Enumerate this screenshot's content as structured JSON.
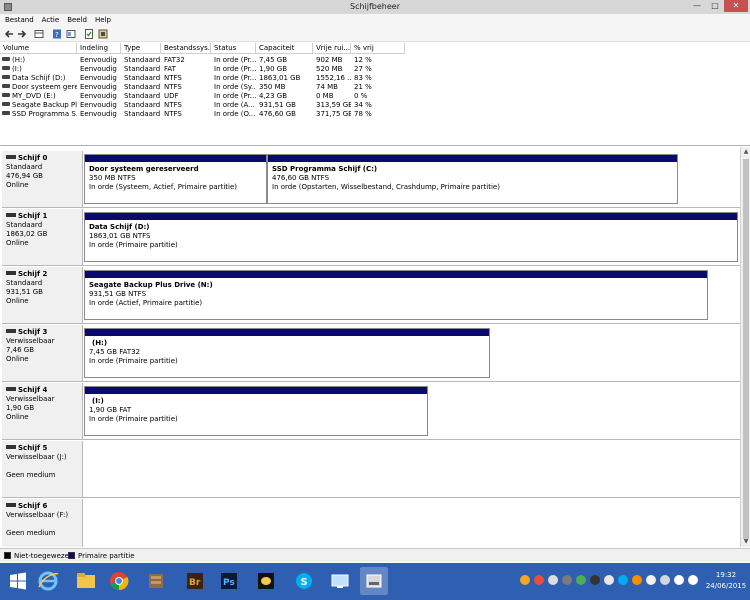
{
  "window": {
    "title": "Schijfbeheer"
  },
  "menu": [
    "Bestand",
    "Actie",
    "Beeld",
    "Help"
  ],
  "toolbar": {
    "icons": [
      "back-arrow-icon",
      "forward-arrow-icon",
      "list-view-icon",
      "help-icon",
      "properties-icon",
      "check-disk-icon",
      "disk-props-icon"
    ]
  },
  "volumes": {
    "columns": [
      "Volume",
      "Indeling",
      "Type",
      "Bestandssys...",
      "Status",
      "Capaciteit",
      "Vrije rui...",
      "% vrij"
    ],
    "rows": [
      [
        "(H:)",
        "Eenvoudig",
        "Standaard",
        "FAT32",
        "In orde (Pr...",
        "7,45 GB",
        "902 MB",
        "12 %"
      ],
      [
        "(I:)",
        "Eenvoudig",
        "Standaard",
        "FAT",
        "In orde (Pr...",
        "1,90 GB",
        "520 MB",
        "27 %"
      ],
      [
        "Data Schijf (D:)",
        "Eenvoudig",
        "Standaard",
        "NTFS",
        "In orde (Pr...",
        "1863,01 GB",
        "1552,16 ...",
        "83 %"
      ],
      [
        "Door systeem gere...",
        "Eenvoudig",
        "Standaard",
        "NTFS",
        "In orde (Sy...",
        "350 MB",
        "74 MB",
        "21 %"
      ],
      [
        "MY_DVD (E:)",
        "Eenvoudig",
        "Standaard",
        "UDF",
        "In orde (Pr...",
        "4,23 GB",
        "0 MB",
        "0 %"
      ],
      [
        "Seagate Backup Pl...",
        "Eenvoudig",
        "Standaard",
        "NTFS",
        "In orde (A...",
        "931,51 GB",
        "313,59 GB",
        "34 %"
      ],
      [
        "SSD Programma S...",
        "Eenvoudig",
        "Standaard",
        "NTFS",
        "In orde (O...",
        "476,60 GB",
        "371,75 GB",
        "78 %"
      ]
    ]
  },
  "disks": [
    {
      "name": "Schijf 0",
      "type": "Standaard",
      "size": "476,94 GB",
      "status": "Online",
      "partitions": [
        {
          "name": "Door systeem gereserveerd",
          "size": "350 MB NTFS",
          "status": "In orde (Systeem, Actief, Primaire partitie)"
        },
        {
          "name": "SSD Programma Schijf  (C:)",
          "size": "476,60 GB NTFS",
          "status": "In orde (Opstarten, Wisselbestand, Crashdump, Primaire partitie)"
        }
      ]
    },
    {
      "name": "Schijf 1",
      "type": "Standaard",
      "size": "1863,02 GB",
      "status": "Online",
      "partitions": [
        {
          "name": "Data Schijf  (D:)",
          "size": "1863,01 GB NTFS",
          "status": "In orde (Primaire partitie)"
        }
      ]
    },
    {
      "name": "Schijf 2",
      "type": "Standaard",
      "size": "931,51 GB",
      "status": "Online",
      "partitions": [
        {
          "name": "Seagate Backup Plus Drive  (N:)",
          "size": "931,51 GB NTFS",
          "status": "In orde (Actief, Primaire partitie)"
        }
      ]
    },
    {
      "name": "Schijf 3",
      "type": "Verwisselbaar",
      "size": "7,46 GB",
      "status": "Online",
      "partitions": [
        {
          "name": "(H:)",
          "size": "7,45 GB FAT32",
          "status": "In orde (Primaire partitie)"
        }
      ]
    },
    {
      "name": "Schijf 4",
      "type": "Verwisselbaar",
      "size": "1,90 GB",
      "status": "Online",
      "partitions": [
        {
          "name": "(I:)",
          "size": "1,90 GB FAT",
          "status": "In orde (Primaire partitie)"
        }
      ]
    },
    {
      "name": "Schijf 5",
      "type": "Verwisselbaar (J:)",
      "size": "",
      "status": "Geen medium",
      "partitions": []
    },
    {
      "name": "Schijf 6",
      "type": "Verwisselbaar (F:)",
      "size": "",
      "status": "Geen medium",
      "partitions": []
    }
  ],
  "legend": [
    {
      "label": "Niet-toegewezen",
      "color": "#000000"
    },
    {
      "label": "Primaire partitie",
      "color": "#0a0a6e"
    }
  ],
  "colors": {
    "partition_bar": "#0a0a6e",
    "taskbar": "#2f5fb0"
  },
  "taskbar": {
    "apps": [
      "start-windows-icon",
      "internet-explorer-icon",
      "file-explorer-icon",
      "chrome-icon",
      "archive-app-icon",
      "adobe-bridge-icon",
      "photoshop-icon",
      "app-icon",
      "skype-icon",
      "remote-desktop-icon",
      "disk-management-icon"
    ],
    "time": "19:32",
    "date": "24/06/2015"
  }
}
